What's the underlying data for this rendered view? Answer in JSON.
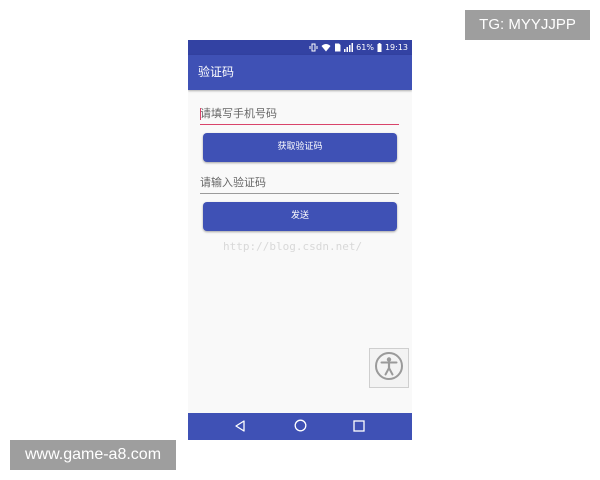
{
  "badges": {
    "telegram": "TG: MYYJJPP",
    "website": "www.game-a8.com"
  },
  "statusbar": {
    "battery": "61%",
    "time": "19:13"
  },
  "appbar": {
    "title": "验证码"
  },
  "form": {
    "phone_placeholder": "请填写手机号码",
    "get_code_button": "获取验证码",
    "code_placeholder": "请输入验证码",
    "send_button": "发送"
  },
  "watermark": "http://blog.csdn.net/",
  "colors": {
    "primary": "#3f51b5",
    "primary_dark": "#3342a3",
    "accent": "#d9446a"
  },
  "icons": [
    "vibrate-icon",
    "wifi-icon",
    "sim-icon",
    "signal-icon",
    "battery-icon",
    "accessibility-icon",
    "back-icon",
    "home-icon",
    "recents-icon"
  ]
}
